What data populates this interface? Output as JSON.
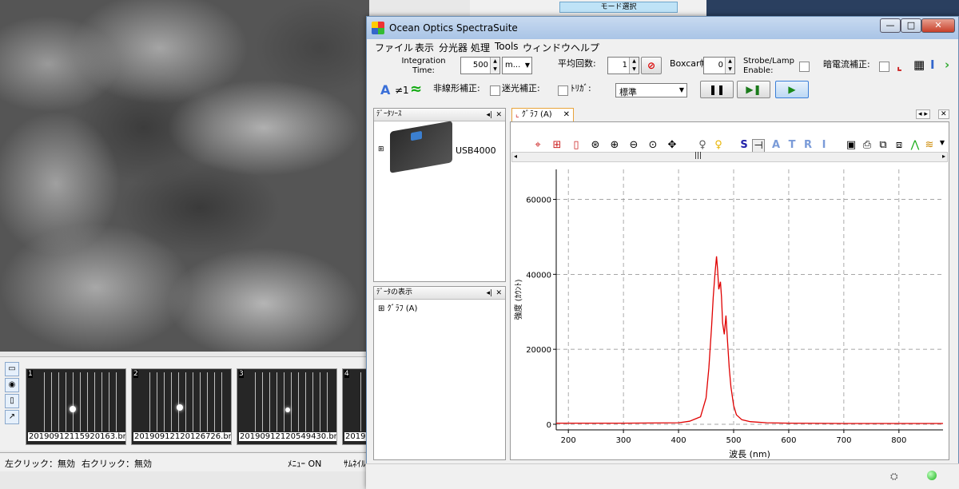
{
  "background_app": {
    "mode_button": "モード選択",
    "thumbnails": [
      {
        "num": "1",
        "file": "20190912115920163.bmp"
      },
      {
        "num": "2",
        "file": "20190912120126726.bmp"
      },
      {
        "num": "3",
        "file": "20190912120549430.bmp"
      },
      {
        "num": "4",
        "file": "2019..."
      }
    ],
    "status": {
      "left_click": "左クリック：無効",
      "right_click": "右クリック：無効",
      "menu": "ﾒﾆｭｰ ON",
      "thumbnail": "ｻﾑﾈｲﾙ"
    }
  },
  "window": {
    "title": "Ocean Optics SpectraSuite",
    "buttons": {
      "minimize": "—",
      "maximize": "□",
      "close": "✕"
    }
  },
  "menu": [
    "ファイル",
    "表示",
    "分光器",
    "処理",
    "Tools",
    "ウィンドウ",
    "ヘルプ"
  ],
  "toolbar": {
    "integration_time_label": "Integration Time:",
    "integration_time_value": "500",
    "integration_unit": "m...",
    "averaging_label": "平均回数:",
    "averaging_value": "1",
    "boxcar_label": "Boxcar幅:",
    "boxcar_value": "0",
    "strobe_label": "Strobe/Lamp Enable:",
    "dark_label": "暗電流補正:",
    "nonlinear_label": "非線形補正:",
    "stray_label": "迷光補正:",
    "trigger_label": "ﾄﾘｶﾞ:",
    "trigger_mode": "標準",
    "ne1_label": "≠1",
    "pause_icon": "pause-icon",
    "step_icon": "step-icon",
    "play_icon": "play-icon"
  },
  "panels": {
    "data_sources_title": "ﾃﾞｰﾀｿｰｽ",
    "device_name": "USB4000",
    "data_views_title": "ﾃﾞｰﾀの表示",
    "graph_node": "ｸﾞﾗﾌ (A)"
  },
  "graph_tab": {
    "label": "ｸﾞﾗﾌ (A)"
  },
  "graph_toolbar_letters": {
    "s": "S",
    "a": "A",
    "t": "T",
    "r": "R",
    "i": "I"
  },
  "colors": {
    "spectrum": "#e00000",
    "accent": "#3a6fd8"
  },
  "chart_data": {
    "type": "line",
    "title": "",
    "xlabel": "波長 (nm)",
    "ylabel": "強度 (ｶｳﾝﾄ)",
    "xlim": [
      178,
      880
    ],
    "ylim": [
      -1500,
      68000
    ],
    "xticks": [
      200,
      300,
      400,
      500,
      600,
      700,
      800
    ],
    "yticks": [
      0,
      20000,
      40000,
      60000
    ],
    "grid": true,
    "series": [
      {
        "x": [
          178,
          300,
          400,
          420,
          440,
          450,
          455,
          460,
          463,
          466,
          469,
          471,
          473,
          476,
          478,
          480,
          483,
          486,
          489,
          492,
          495,
          500,
          505,
          515,
          530,
          560,
          600,
          700,
          800,
          880
        ],
        "y": [
          300,
          300,
          400,
          800,
          2000,
          7000,
          15000,
          26000,
          34000,
          40000,
          44800,
          41000,
          36000,
          38000,
          34000,
          27000,
          24000,
          29000,
          22000,
          15000,
          10000,
          5000,
          2500,
          1200,
          700,
          400,
          300,
          200,
          200,
          200
        ]
      }
    ]
  }
}
